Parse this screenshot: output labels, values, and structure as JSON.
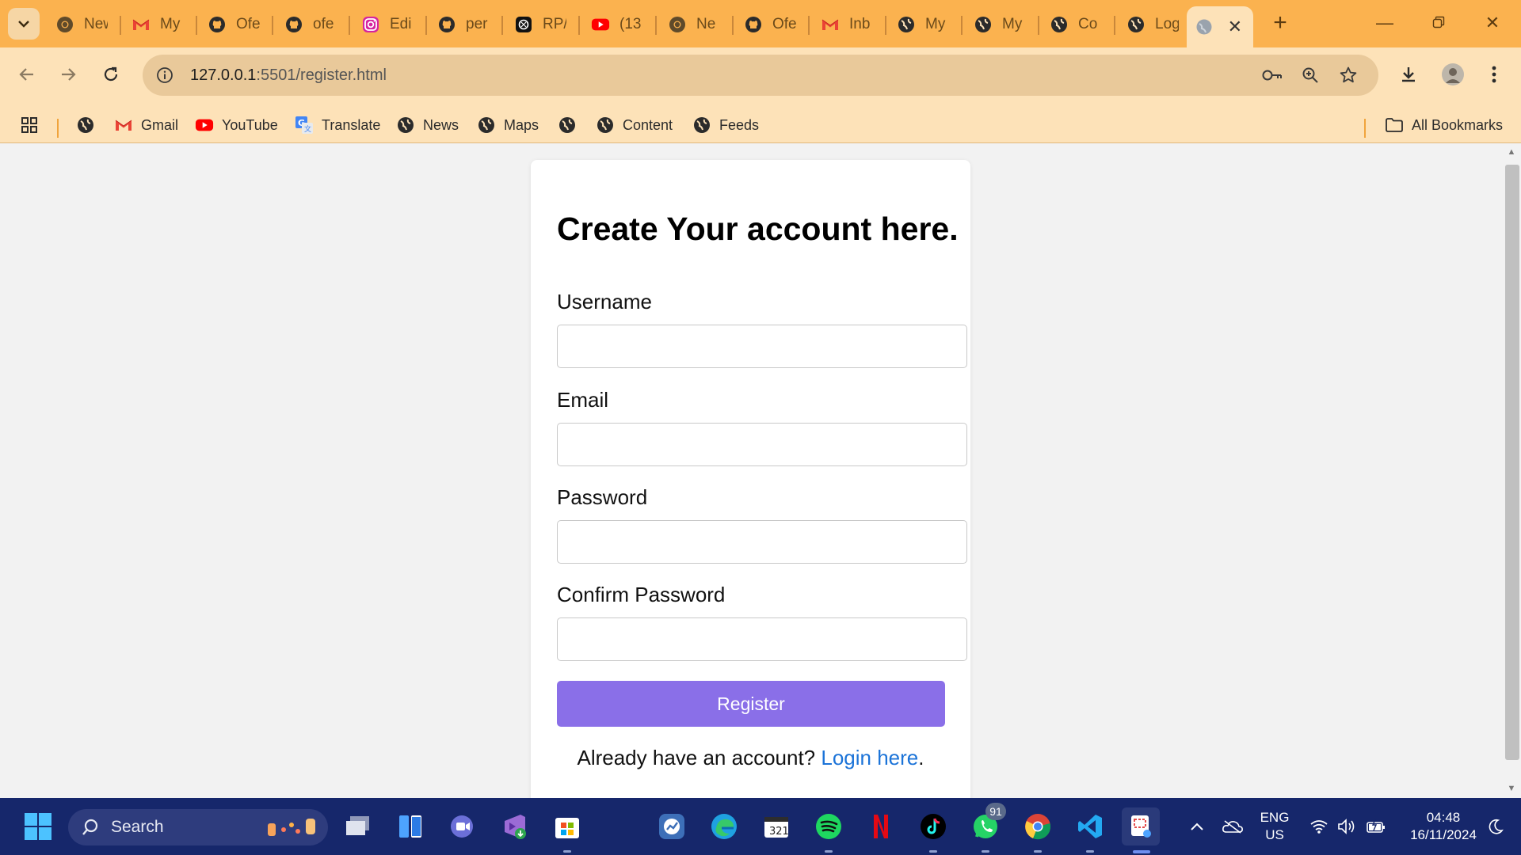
{
  "browser": {
    "tabs": [
      {
        "title": "New",
        "icon": "chrome-icon"
      },
      {
        "title": "My",
        "icon": "gmail-icon"
      },
      {
        "title": "Ofe",
        "icon": "github-icon"
      },
      {
        "title": "ofe",
        "icon": "github-icon"
      },
      {
        "title": "Edi",
        "icon": "instagram-icon"
      },
      {
        "title": "per",
        "icon": "github-icon"
      },
      {
        "title": "RP/",
        "icon": "chatgpt-icon"
      },
      {
        "title": "(13",
        "icon": "youtube-icon"
      },
      {
        "title": "Ne",
        "icon": "chrome-icon"
      },
      {
        "title": "Ofe",
        "icon": "github-icon"
      },
      {
        "title": "Inb",
        "icon": "gmail-icon"
      },
      {
        "title": "My",
        "icon": "globe-icon"
      },
      {
        "title": "My",
        "icon": "globe-icon"
      },
      {
        "title": "Co",
        "icon": "globe-icon"
      },
      {
        "title": "Log",
        "icon": "globe-icon"
      }
    ],
    "active_tab": {
      "title": "",
      "icon": "globe-icon"
    },
    "url": {
      "host": "127.0.0.1",
      "path": ":5501/register.html"
    },
    "bookmarks": [
      {
        "label": "",
        "icon": "globe-icon"
      },
      {
        "label": "Gmail",
        "icon": "gmail-icon"
      },
      {
        "label": "YouTube",
        "icon": "youtube-icon"
      },
      {
        "label": "Translate",
        "icon": "translate-icon"
      },
      {
        "label": "News",
        "icon": "globe-icon"
      },
      {
        "label": "Maps",
        "icon": "globe-icon"
      },
      {
        "label": "",
        "icon": "globe-icon"
      },
      {
        "label": "Content",
        "icon": "globe-icon"
      },
      {
        "label": "Feeds",
        "icon": "globe-icon"
      }
    ],
    "all_bookmarks_label": "All Bookmarks"
  },
  "page": {
    "heading": "Create Your account here.",
    "fields": [
      {
        "label": "Username",
        "value": "",
        "type": "text"
      },
      {
        "label": "Email",
        "value": "",
        "type": "email"
      },
      {
        "label": "Password",
        "value": "",
        "type": "password"
      },
      {
        "label": "Confirm Password",
        "value": "",
        "type": "password"
      }
    ],
    "register_button": "Register",
    "login_prompt": "Already have an account?",
    "login_link": "Login here",
    "login_suffix": "."
  },
  "taskbar": {
    "search_label": "Search",
    "whatsapp_badge": "91",
    "language": "ENG",
    "region": "US",
    "time": "04:48",
    "date": "16/11/2024"
  },
  "colors": {
    "tabstrip": "#fbb24f",
    "toolbar": "#fde2b8",
    "button": "#8a6fe8",
    "link": "#1b73d8",
    "taskbar": "#16276b"
  }
}
